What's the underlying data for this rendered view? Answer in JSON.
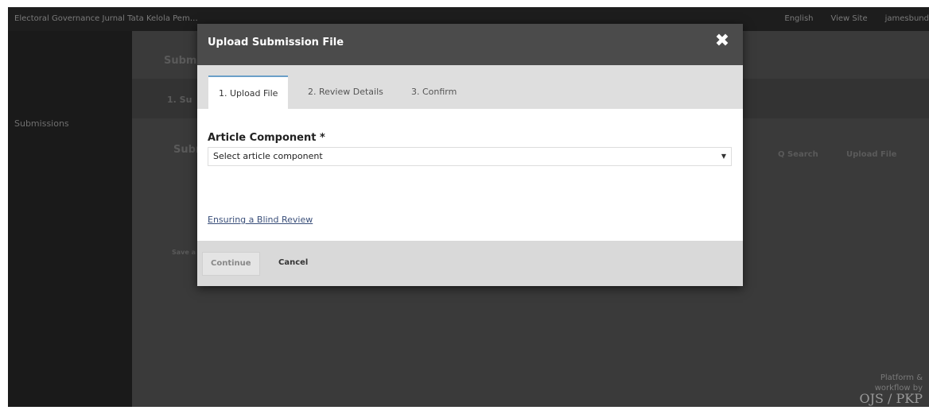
{
  "app": {
    "brand": "Electoral Governance Jurnal Tata Kelola Pem…",
    "top_right": [
      "English",
      "View Site",
      "jamesbund"
    ]
  },
  "sidebar": {
    "items": [
      {
        "label": "Submissions"
      }
    ]
  },
  "background": {
    "heading": "Subm",
    "step": "1. Su",
    "section": "Subm",
    "search": "Q Search",
    "upload_file": "Upload File",
    "save": "Save a",
    "footer_line1": "Platform &",
    "footer_line2": "workflow by",
    "footer_logo": "OJS / PKP"
  },
  "modal": {
    "title": "Upload Submission File",
    "close_icon": "close-icon",
    "tabs": [
      "1. Upload File",
      "2. Review Details",
      "3. Confirm"
    ],
    "active_tab": 0,
    "field_label": "Article Component *",
    "select_value": "Select article component",
    "blind_review_link": "Ensuring a Blind Review",
    "buttons": {
      "continue": "Continue",
      "cancel": "Cancel"
    }
  },
  "colors": {
    "modal_header": "#4b4b4b",
    "tab_bar": "#dedede",
    "active_tab_border": "#6a9fc8",
    "overlay_dark": "#2f2f2f",
    "link": "#3a4f7a"
  }
}
